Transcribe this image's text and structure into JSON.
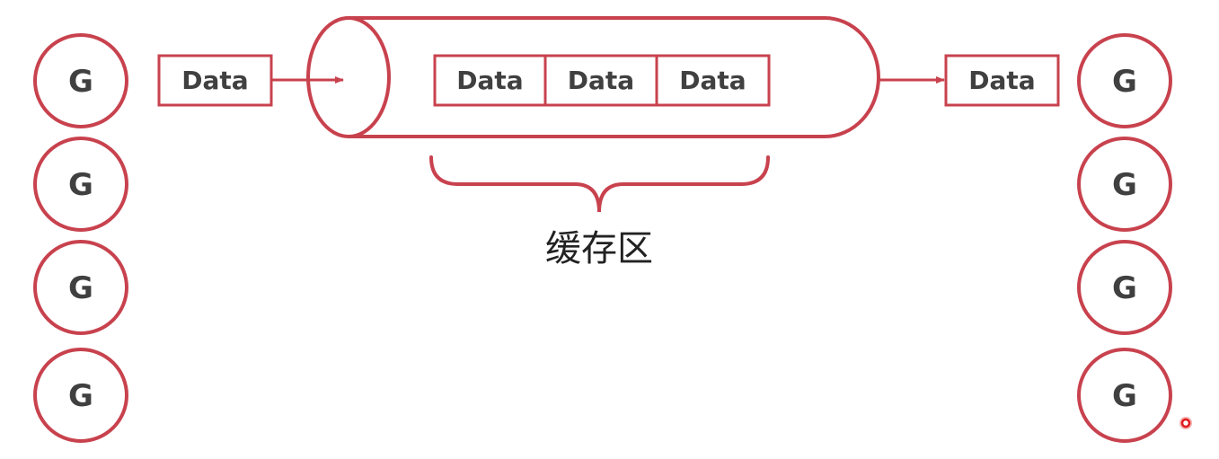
{
  "diagram": {
    "colors": {
      "stroke": "#c8424e",
      "text": "#404040",
      "pointer": "#e01b1b"
    },
    "left_goroutines": [
      "G",
      "G",
      "G",
      "G"
    ],
    "right_goroutines": [
      "G",
      "G",
      "G",
      "G"
    ],
    "input_data": "Data",
    "buffer_items": [
      "Data",
      "Data",
      "Data"
    ],
    "output_data": "Data",
    "buffer_label": "缓存区"
  }
}
